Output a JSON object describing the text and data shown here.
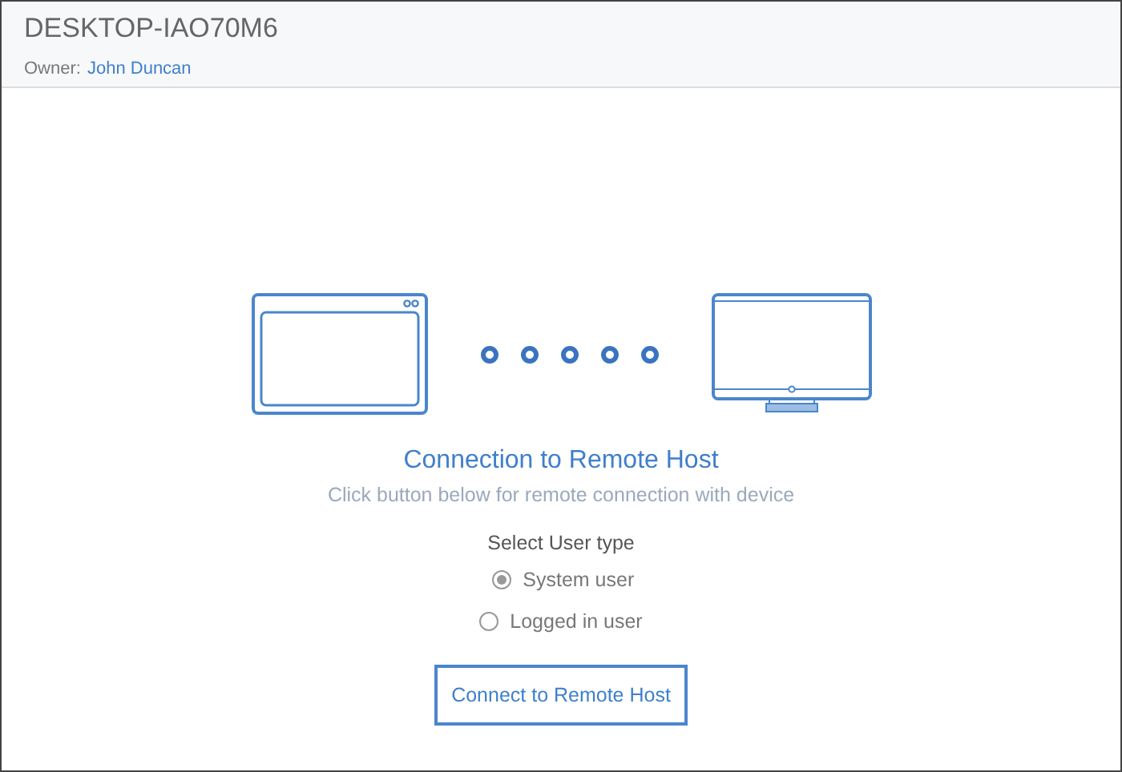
{
  "header": {
    "title": "DESKTOP-IAO70M6",
    "owner_label": "Owner:",
    "owner_name": "John Duncan"
  },
  "heading": "Connection to Remote Host",
  "subtitle": "Click button below for remote connection with device",
  "user_type": {
    "label": "Select User type",
    "options": [
      {
        "label": "System user",
        "selected": true
      },
      {
        "label": "Logged in user",
        "selected": false
      }
    ]
  },
  "button": "Connect to Remote Host"
}
